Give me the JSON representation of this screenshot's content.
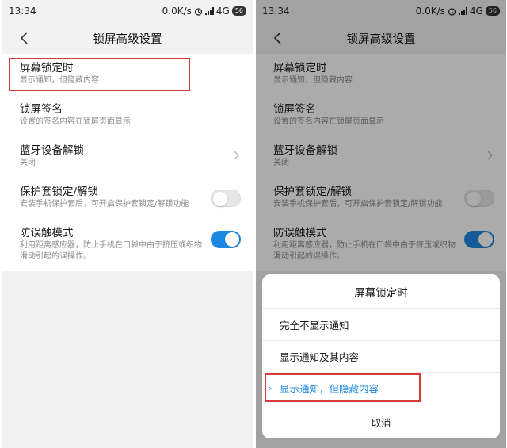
{
  "status": {
    "time": "13:34",
    "speed": "0.0K/s",
    "network": "4G",
    "battery": "56"
  },
  "header": {
    "title": "锁屏高级设置"
  },
  "settings": [
    {
      "title": "屏幕锁定时",
      "subtitle": "显示通知，但隐藏内容"
    },
    {
      "title": "锁屏签名",
      "subtitle": "设置的签名内容在锁屏页面显示"
    },
    {
      "title": "蓝牙设备解锁",
      "subtitle": "关闭"
    },
    {
      "title": "保护套锁定/解锁",
      "subtitle": "安装手机保护套后，可开启保护套锁定/解锁功能",
      "toggle": false
    },
    {
      "title": "防误触模式",
      "subtitle": "利用距离感应器，防止手机在口袋中由于挤压或织物滑动引起的误操作。",
      "toggle": true
    }
  ],
  "dialog": {
    "title": "屏幕锁定时",
    "options": [
      "完全不显示通知",
      "显示通知及其内容",
      "显示通知，但隐藏内容"
    ],
    "selected_index": 2,
    "cancel": "取消"
  },
  "colors": {
    "accent": "#1c88e3",
    "highlight": "#d63a3a"
  }
}
